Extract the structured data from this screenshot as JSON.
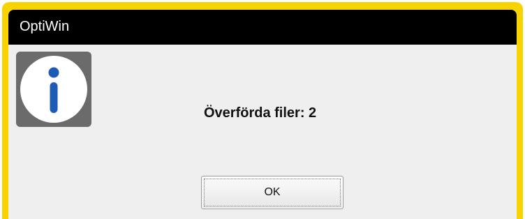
{
  "window": {
    "title": "OptiWin",
    "frame_color": "#f7d400",
    "titlebar_color": "#000000"
  },
  "dialog": {
    "icon": "info-icon",
    "message": "Överförda filer: 2"
  },
  "buttons": {
    "ok_label": "OK"
  }
}
